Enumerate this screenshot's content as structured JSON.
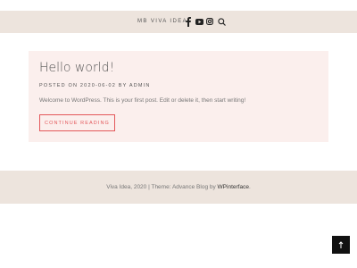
{
  "header": {
    "site_title": "MB VIVA IDEA",
    "social_icons": [
      "facebook-icon",
      "youtube-icon",
      "instagram-icon"
    ],
    "search_icon": "search-icon"
  },
  "post": {
    "title": "Hello world!",
    "meta": "POSTED ON 2020-06-02 BY ADMIN",
    "excerpt": "Welcome to WordPress. This is your first post. Edit or delete it, then start writing!",
    "continue_label": "CONTINUE READING"
  },
  "footer": {
    "text_before": "Viva Idea, 2020 | Theme: Advance Blog by ",
    "link_text": "WPinterface",
    "text_after": "."
  },
  "colors": {
    "header_bg": "#ede4dd",
    "card_bg": "#fbefed",
    "accent": "#e3575a",
    "scroll_btn": "#111111"
  },
  "scroll_top_icon": "arrow-up-icon"
}
